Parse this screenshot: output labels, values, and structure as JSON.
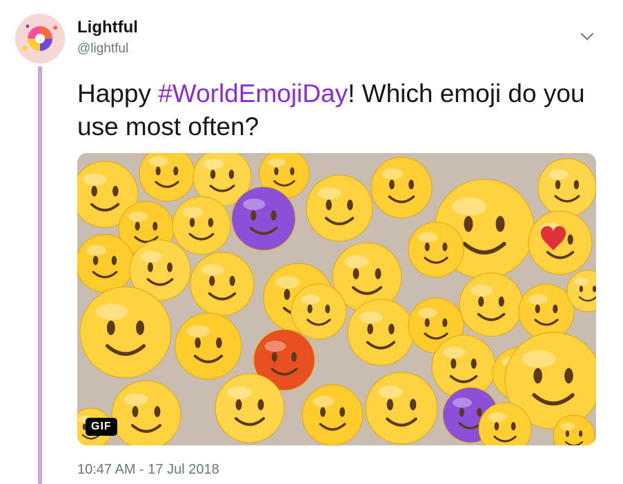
{
  "author": {
    "name": "Lightful",
    "handle": "@lightful"
  },
  "tweet": {
    "text_before": "Happy ",
    "hashtag": "#WorldEmojiDay",
    "text_after": "! Which emoji do you use most often?",
    "timestamp": "10:47 AM - 17 Jul 2018"
  },
  "media": {
    "type": "gif",
    "badge_label": "GIF"
  },
  "icons": {
    "menu": "chevron-down-icon",
    "avatar": "lightful-logo"
  },
  "colors": {
    "hashtag": "#8a2be2",
    "thread_line": "#c9a4ef",
    "secondary_text": "#657786"
  }
}
